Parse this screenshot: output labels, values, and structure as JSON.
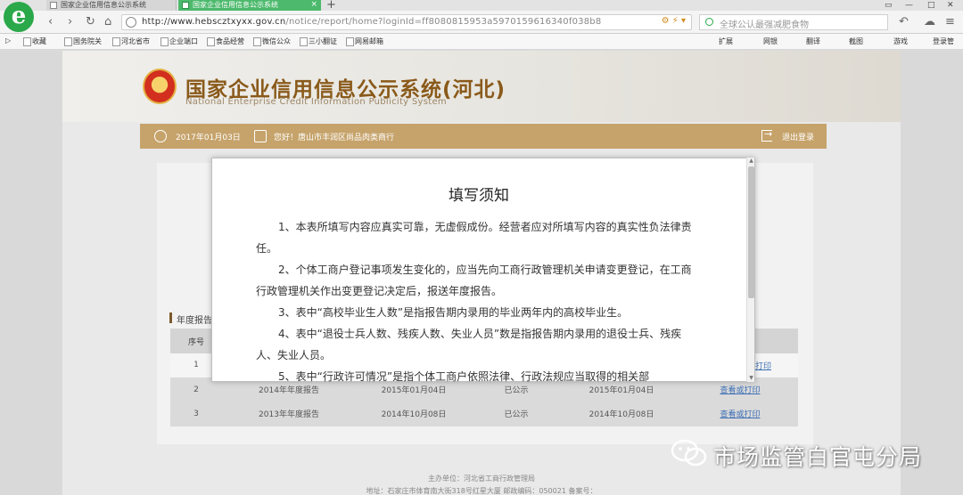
{
  "browser": {
    "tabs": [
      {
        "label": "国家企业信用信息公示系统"
      },
      {
        "label": "国家企业信用信息公示系统"
      }
    ],
    "address": {
      "url_host": "http://www.hebscztxyxx.gov.cn",
      "url_path": "/notice/report/home?loginId=ff8080815953a5970159616340f038b8"
    },
    "search_placeholder": "全球公认最强减肥食物",
    "bookmarks": [
      "收藏",
      "国务院关",
      "河北省市",
      "企业端口",
      "食品经营",
      "微信公众",
      "三小翻证",
      "网易邮箱"
    ],
    "right_tools": [
      "扩展",
      "网银",
      "翻译",
      "截图",
      "游戏",
      "登录管"
    ]
  },
  "site": {
    "title": "国家企业信用信息公示系统(河北)",
    "subtitle": "National Enterprise Credit Information Publicity System"
  },
  "userbar": {
    "date": "2017年01月03日",
    "greeting": "您好！唐山市丰润区尚品肉类商行",
    "logout": "退出登录"
  },
  "section": {
    "title": "年度报告"
  },
  "table": {
    "headers": [
      "序号",
      "",
      "",
      "",
      "",
      ""
    ],
    "rows": [
      {
        "no": "1",
        "year": "",
        "date1": "",
        "status": "",
        "date2": "",
        "action": "打印"
      },
      {
        "no": "2",
        "year": "2014年年度报告",
        "date1": "2015年01月04日",
        "status": "已公示",
        "date2": "2015年01月04日",
        "action": "查看或打印"
      },
      {
        "no": "3",
        "year": "2013年年度报告",
        "date1": "2014年10月08日",
        "status": "已公示",
        "date2": "2014年10月08日",
        "action": "查看或打印"
      }
    ]
  },
  "modal": {
    "title": "填写须知",
    "paragraphs": [
      "1、本表所填写内容应真实可靠，无虚假成份。经营者应对所填写内容的真实性负法律责任。",
      "2、个体工商户登记事项发生变化的，应当先向工商行政管理机关申请变更登记，在工商行政管理机关作出变更登记决定后，报送年度报告。",
      "3、表中“高校毕业生人数”是指报告期内录用的毕业两年内的高校毕业生。",
      "4、表中“退役士兵人数、残疾人数、失业人员”数是指报告期内录用的退役士兵、残疾人、失业人员。",
      "5、表中“行政许可情况”是指个体工商户依照法律、行政法规应当取得的相关部"
    ]
  },
  "footer": {
    "line1": "主办单位：河北省工商行政管理局",
    "line2": "地址：石家庄市体育南大街318号红星大厦 邮政编码：050021 备案号："
  },
  "watermark": {
    "text": "市场监管白官屯分局"
  }
}
